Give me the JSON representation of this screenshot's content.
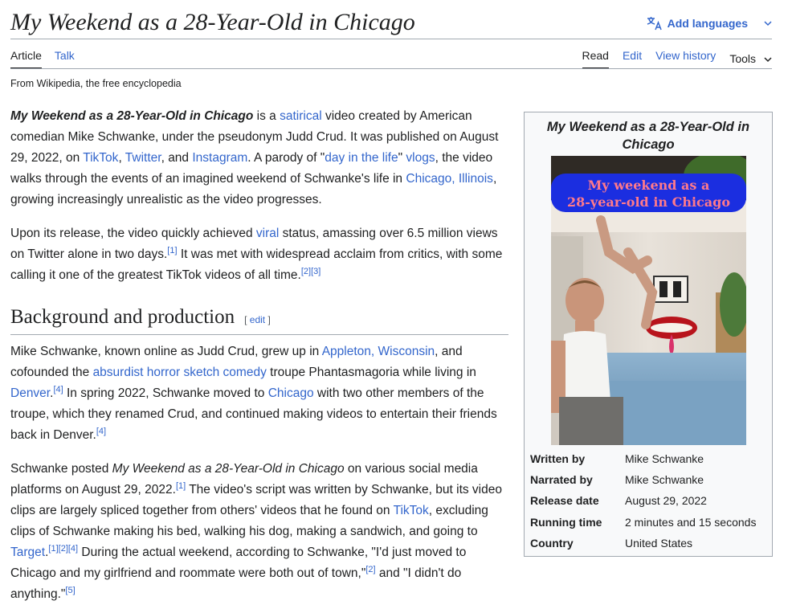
{
  "page": {
    "title": "My Weekend as a 28-Year-Old in Chicago",
    "add_languages": "Add languages",
    "tagline": "From Wikipedia, the free encyclopedia"
  },
  "tabs_left": [
    {
      "label": "Article",
      "active": true
    },
    {
      "label": "Talk",
      "active": false
    }
  ],
  "tabs_right": [
    {
      "label": "Read",
      "active": true
    },
    {
      "label": "Edit",
      "active": false
    },
    {
      "label": "View history",
      "active": false
    },
    {
      "label": "Tools",
      "active": false
    }
  ],
  "article": {
    "p1": {
      "t1": "My Weekend as a 28-Year-Old in Chicago",
      "t2": " is a ",
      "l1": "satirical",
      "t3": " video created by American comedian Mike Schwanke, under the pseudonym Judd Crud. It was published on August 29, 2022, on ",
      "l2": "TikTok",
      "t4": ", ",
      "l3": "Twitter",
      "t5": ", and ",
      "l4": "Instagram",
      "t6": ". A parody of \"",
      "l5": "day in the life",
      "t7": "\" ",
      "l6": "vlogs",
      "t8": ", the video walks through the events of an imagined weekend of Schwanke's life in ",
      "l7": "Chicago, Illinois",
      "t9": ", growing increasingly unrealistic as the video progresses."
    },
    "p2": {
      "t1": "Upon its release, the video quickly achieved ",
      "l1": "viral",
      "t2": " status, amassing over 6.5 million views on Twitter alone in two days.",
      "r1": "[1]",
      "t3": " It was met with widespread acclaim from critics, with some calling it one of the greatest TikTok videos of all time.",
      "r2": "[2]",
      "r3": "[3]"
    },
    "section": {
      "heading": "Background and production",
      "edit_open": "[ ",
      "edit_label": "edit",
      "edit_close": " ]"
    },
    "p3": {
      "t1": "Mike Schwanke, known online as Judd Crud, grew up in ",
      "l1": "Appleton, Wisconsin",
      "t2": ", and cofounded the ",
      "l2": "absurdist",
      "t3": " ",
      "l3": "horror",
      "t4": " ",
      "l4": "sketch comedy",
      "t5": " troupe Phantasmagoria while living in ",
      "l5": "Denver",
      "t6": ".",
      "r1": "[4]",
      "t7": " In spring 2022, Schwanke moved to ",
      "l6": "Chicago",
      "t8": " with two other members of the troupe, which they renamed Crud, and continued making videos to entertain their friends back in Denver.",
      "r2": "[4]"
    },
    "p4": {
      "t1": "Schwanke posted ",
      "t2": "My Weekend as a 28-Year-Old in Chicago",
      "t3": " on various social media platforms on August 29, 2022.",
      "r1": "[1]",
      "t4": " The video's script was written by Schwanke, but its video clips are largely spliced together from others' videos that he found on ",
      "l1": "TikTok",
      "t5": ", excluding clips of Schwanke making his bed, walking his dog, making a sandwich, and going to ",
      "l2": "Target",
      "t6": ".",
      "r2": "[1]",
      "r3": "[2]",
      "r4": "[4]",
      "t7": " During the actual weekend, according to Schwanke, \"I'd just moved to Chicago and my girlfriend and roommate were both out of town,\"",
      "r5": "[2]",
      "t8": " and \"I didn't do anything.\"",
      "r6": "[5]"
    }
  },
  "infobox": {
    "title": "My Weekend as a 28-Year-Old in Chicago",
    "image_caption_line1": "My weekend as a",
    "image_caption_line2": "28-year-old in Chicago",
    "rows": [
      {
        "label": "Written by",
        "value": "Mike Schwanke"
      },
      {
        "label": "Narrated by",
        "value": "Mike Schwanke"
      },
      {
        "label": "Release date",
        "value": "August 29, 2022"
      },
      {
        "label": "Running time",
        "value": "2 minutes and 15 seconds"
      },
      {
        "label": "Country",
        "value": "United States"
      }
    ]
  },
  "colors": {
    "link": "#3366cc",
    "text": "#202122",
    "rule": "#a2a9b1",
    "infobox_bg": "#f8f9fa",
    "banner_blue": "#1b2ee0",
    "banner_text": "#ff7a8a"
  },
  "icons": {
    "translate": "translate-icon",
    "chevron": "chevron-down-icon"
  }
}
